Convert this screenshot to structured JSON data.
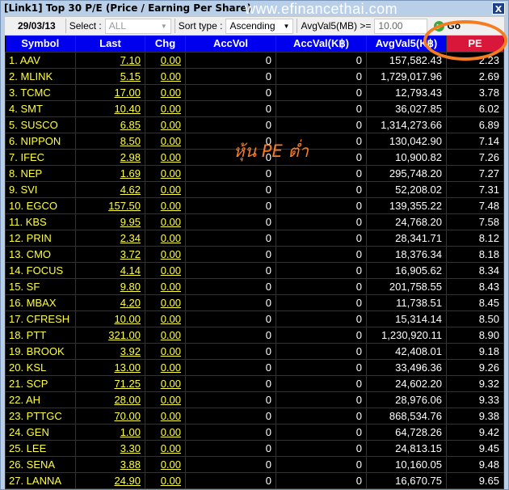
{
  "window": {
    "title": "[Link1] Top 30 P/E (Price / Earning Per Share)",
    "watermark": "www.efinancethai.com",
    "close": "X"
  },
  "toolbar": {
    "date": "29/03/13",
    "select_label": "Select :",
    "select_value": "ALL",
    "sort_label": "Sort type :",
    "sort_value": "Ascending",
    "avg_label": "AvgVal5(MB) >=",
    "avg_value": "10.00",
    "go_label": "Go"
  },
  "columns": [
    "Symbol",
    "Last",
    "Chg",
    "AccVol",
    "AccVal(K฿)",
    "AvgVal5(K฿)",
    "PE"
  ],
  "overlay_text": "หุ้น PE ต่ำ",
  "colors": {
    "header": "#0000ee",
    "pe_header": "#d9173a",
    "highlight": "#f57c20",
    "symbol": "#ffff40"
  },
  "rows": [
    [
      "1. AAV",
      "7.10",
      "0.00",
      "0",
      "0",
      "157,582.43",
      "2.23"
    ],
    [
      "2. MLINK",
      "5.15",
      "0.00",
      "0",
      "0",
      "1,729,017.96",
      "2.69"
    ],
    [
      "3. TCMC",
      "17.00",
      "0.00",
      "0",
      "0",
      "12,793.43",
      "3.78"
    ],
    [
      "4. SMT",
      "10.40",
      "0.00",
      "0",
      "0",
      "36,027.85",
      "6.02"
    ],
    [
      "5. SUSCO",
      "6.85",
      "0.00",
      "0",
      "0",
      "1,314,273.66",
      "6.89"
    ],
    [
      "6. NIPPON",
      "8.50",
      "0.00",
      "0",
      "0",
      "130,042.90",
      "7.14"
    ],
    [
      "7. IFEC",
      "2.98",
      "0.00",
      "0",
      "0",
      "10,900.82",
      "7.26"
    ],
    [
      "8. NEP",
      "1.69",
      "0.00",
      "0",
      "0",
      "295,748.20",
      "7.27"
    ],
    [
      "9. SVI",
      "4.62",
      "0.00",
      "0",
      "0",
      "52,208.02",
      "7.31"
    ],
    [
      "10. EGCO",
      "157.50",
      "0.00",
      "0",
      "0",
      "139,355.22",
      "7.48"
    ],
    [
      "11. KBS",
      "9.95",
      "0.00",
      "0",
      "0",
      "24,768.20",
      "7.58"
    ],
    [
      "12. PRIN",
      "2.34",
      "0.00",
      "0",
      "0",
      "28,341.71",
      "8.12"
    ],
    [
      "13. CMO",
      "3.72",
      "0.00",
      "0",
      "0",
      "18,376.34",
      "8.18"
    ],
    [
      "14. FOCUS",
      "4.14",
      "0.00",
      "0",
      "0",
      "16,905.62",
      "8.34"
    ],
    [
      "15. SF",
      "9.80",
      "0.00",
      "0",
      "0",
      "201,758.55",
      "8.43"
    ],
    [
      "16. MBAX",
      "4.20",
      "0.00",
      "0",
      "0",
      "11,738.51",
      "8.45"
    ],
    [
      "17. CFRESH",
      "10.00",
      "0.00",
      "0",
      "0",
      "15,314.14",
      "8.50"
    ],
    [
      "18. PTT",
      "321.00",
      "0.00",
      "0",
      "0",
      "1,230,920.11",
      "8.90"
    ],
    [
      "19. BROOK",
      "3.92",
      "0.00",
      "0",
      "0",
      "42,408.01",
      "9.18"
    ],
    [
      "20. KSL",
      "13.00",
      "0.00",
      "0",
      "0",
      "33,496.36",
      "9.26"
    ],
    [
      "21. SCP",
      "71.25",
      "0.00",
      "0",
      "0",
      "24,602.20",
      "9.32"
    ],
    [
      "22. AH",
      "28.00",
      "0.00",
      "0",
      "0",
      "28,976.06",
      "9.33"
    ],
    [
      "23. PTTGC",
      "70.00",
      "0.00",
      "0",
      "0",
      "868,534.76",
      "9.38"
    ],
    [
      "24. GEN",
      "1.00",
      "0.00",
      "0",
      "0",
      "64,728.26",
      "9.42"
    ],
    [
      "25. LEE",
      "3.30",
      "0.00",
      "0",
      "0",
      "24,813.15",
      "9.45"
    ],
    [
      "26. SENA",
      "3.88",
      "0.00",
      "0",
      "0",
      "10,160.05",
      "9.48"
    ],
    [
      "27. LANNA",
      "24.90",
      "0.00",
      "0",
      "0",
      "16,670.75",
      "9.65"
    ]
  ]
}
